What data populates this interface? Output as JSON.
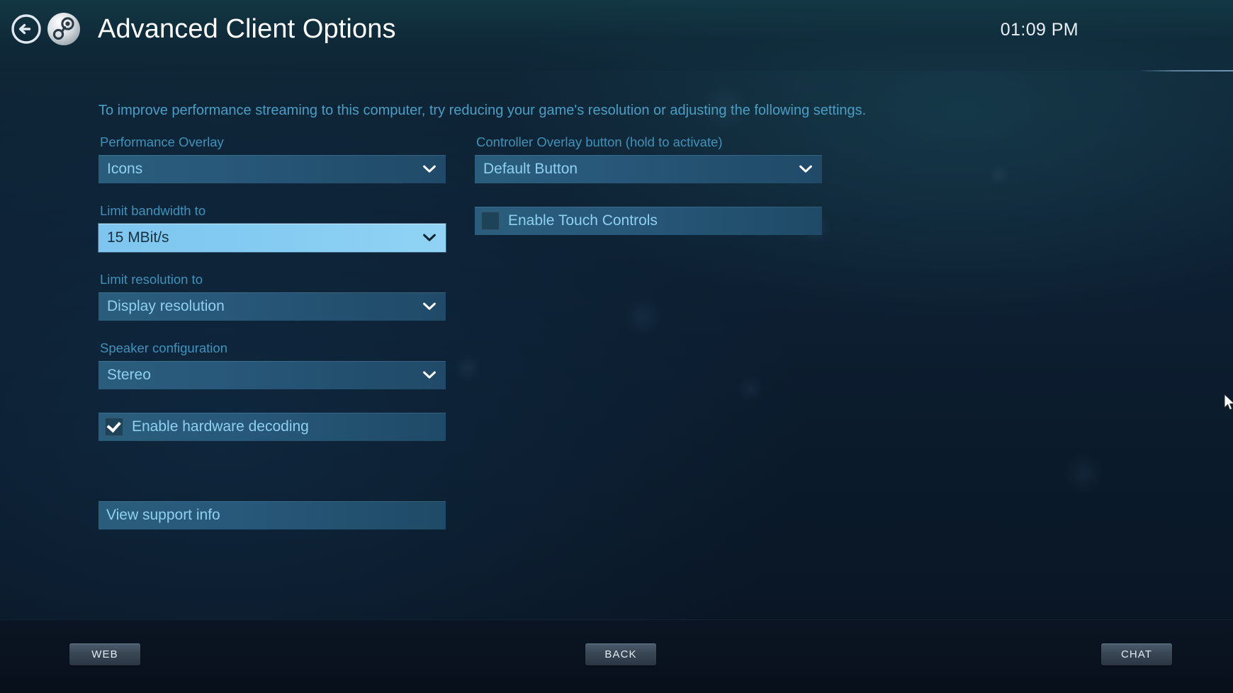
{
  "header": {
    "title": "Advanced Client Options",
    "clock": "01:09 PM",
    "back_icon": "back-arrow-icon",
    "logo_icon": "steam-logo-icon"
  },
  "main": {
    "intro": "To improve performance streaming to this computer, try reducing your game's resolution or adjusting the following settings.",
    "left_column": [
      {
        "kind": "dropdown",
        "name": "performance-overlay",
        "label": "Performance Overlay",
        "value": "Icons",
        "selected": false
      },
      {
        "kind": "dropdown",
        "name": "limit-bandwidth",
        "label": "Limit bandwidth to",
        "value": "15 MBit/s",
        "selected": true
      },
      {
        "kind": "dropdown",
        "name": "limit-resolution",
        "label": "Limit resolution to",
        "value": "Display resolution",
        "selected": false
      },
      {
        "kind": "dropdown",
        "name": "speaker-configuration",
        "label": "Speaker configuration",
        "value": "Stereo",
        "selected": false
      },
      {
        "kind": "checkbox",
        "name": "enable-hardware-decoding",
        "label": "Enable hardware decoding",
        "checked": true
      },
      {
        "kind": "action",
        "name": "view-support-info",
        "label": "View support info"
      }
    ],
    "right_column": [
      {
        "kind": "dropdown",
        "name": "controller-overlay-button",
        "label": "Controller Overlay button (hold to activate)",
        "value": "Default Button",
        "selected": false
      },
      {
        "kind": "checkbox",
        "name": "enable-touch-controls",
        "label": "Enable Touch Controls",
        "checked": false
      }
    ]
  },
  "footer": {
    "web_label": "WEB",
    "back_label": "BACK",
    "chat_label": "CHAT"
  },
  "colors": {
    "accent_highlight": "#84cbf2",
    "label_blue": "#3f93bb",
    "value_blue": "#8fd0f0",
    "intro_blue": "#4a9ec4",
    "row_blue": "#28587a",
    "page_bg": "#0d2033"
  }
}
